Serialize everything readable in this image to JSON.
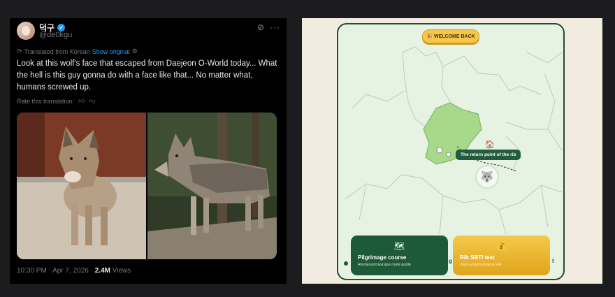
{
  "tweet": {
    "display_name": "덕구",
    "handle": "@de0kgu",
    "translated_label": "Translated from Korean",
    "show_original": "Show original",
    "body": "Look at this wolf's face that escaped from Daejeon O-World today... What the hell is this guy gonna do with a face like that... No matter what, humans screwed up.",
    "rate_label": "Rate this translation:",
    "timestamp": "10:30 PM · Apr 7, 2026 ·",
    "views_count": "2.4M",
    "views_label": "Views",
    "icons": [
      "verified-badge-icon",
      "grok-icon",
      "more-icon",
      "translate-icon",
      "thumbs-up-icon",
      "thumbs-down-icon"
    ],
    "colors": {
      "background": "#000000",
      "text": "#e7e9ea",
      "muted": "#71767b",
      "link": "#1d9bf0"
    }
  },
  "app": {
    "welcome_label": "WELCOME BACK",
    "tooltip_text": "The return point of the rib",
    "cards": [
      {
        "title": "Pilgrimage course",
        "subtitle": "Restaurant Escape route guide",
        "icon": "map-icon"
      },
      {
        "title": "Rib SBTI test",
        "subtitle": "Just a psychological test",
        "icon": "money-bag-icon"
      }
    ],
    "peek_left": "g",
    "peek_right": "t",
    "colors": {
      "frame": "#1f4d36",
      "map_bg": "#e6f3e3",
      "region_fill": "#a8d98a",
      "accent_gold": "#f4c94c",
      "tooltip": "#225c3d"
    }
  }
}
